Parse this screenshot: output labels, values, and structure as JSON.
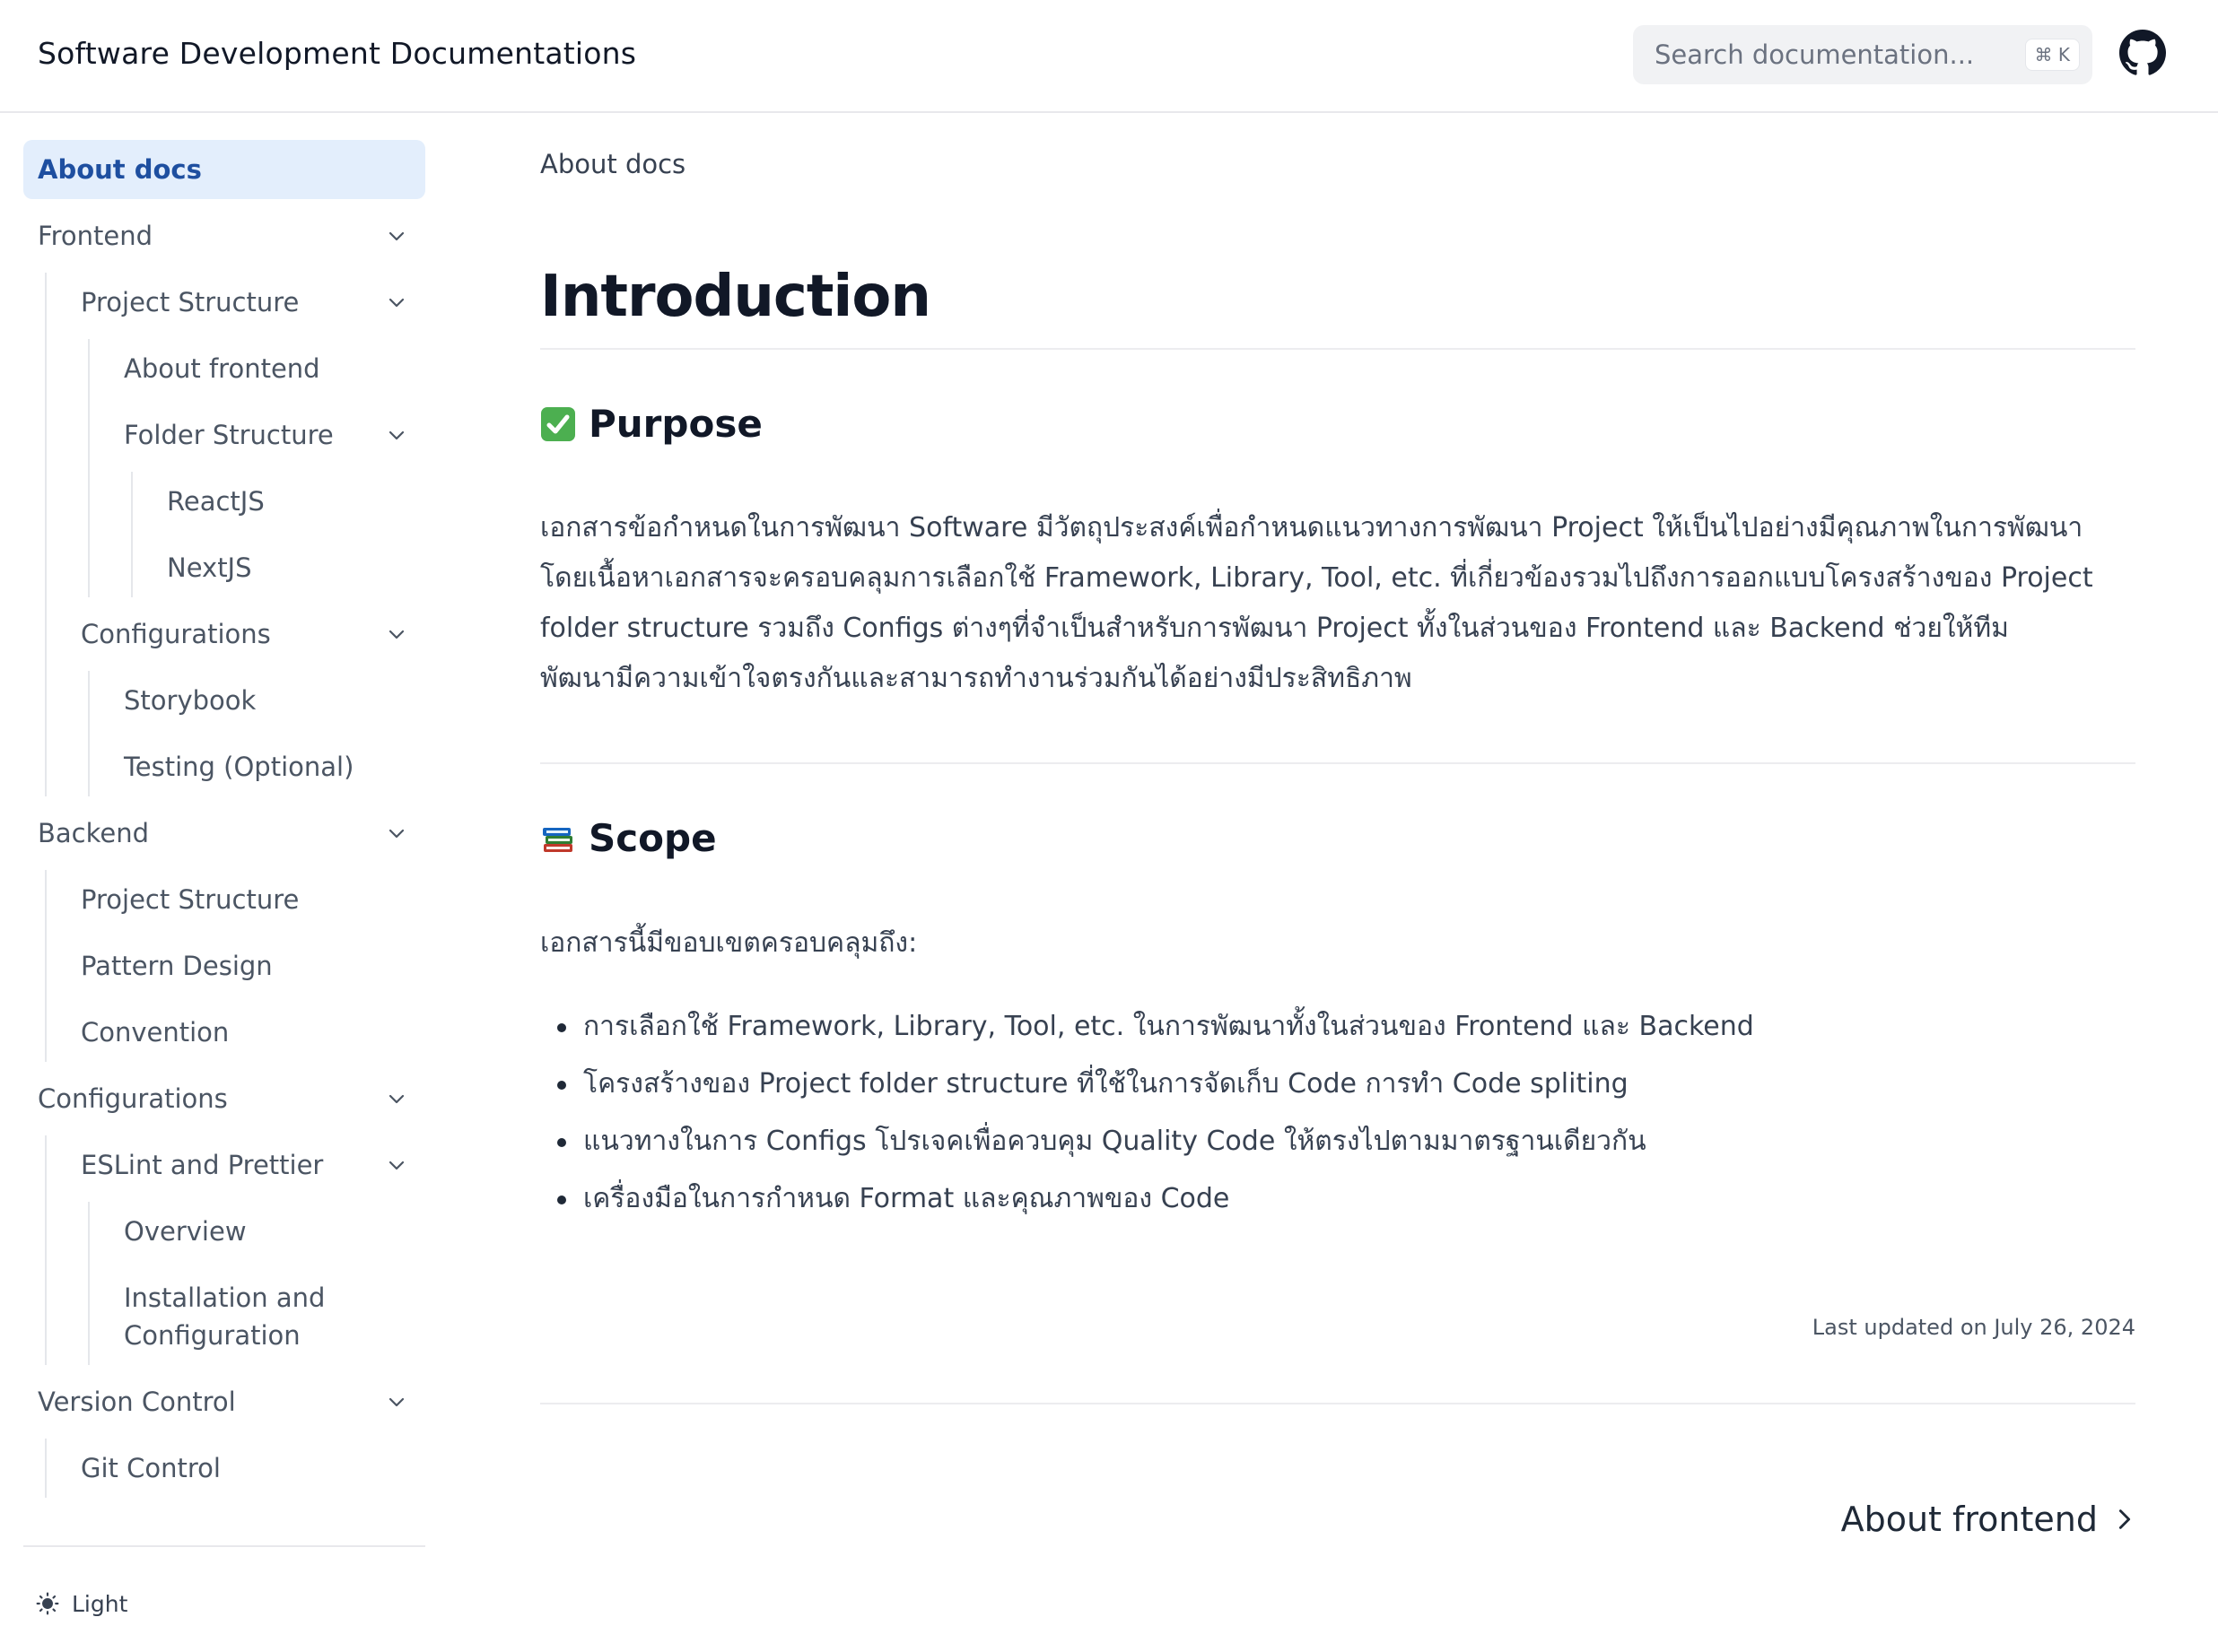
{
  "header": {
    "site_title": "Software Development Documentations",
    "search_placeholder": "Search documentation...",
    "search_shortcut": "⌘ K",
    "github_icon": "github-icon"
  },
  "sidebar": {
    "items": [
      {
        "label": "About docs",
        "level": 0,
        "active": true,
        "expandable": false
      },
      {
        "label": "Frontend",
        "level": 0,
        "expandable": true
      },
      {
        "label": "Project Structure",
        "level": 1,
        "expandable": true
      },
      {
        "label": "About frontend",
        "level": 2,
        "expandable": false
      },
      {
        "label": "Folder Structure",
        "level": 2,
        "expandable": true
      },
      {
        "label": "ReactJS",
        "level": 3,
        "expandable": false
      },
      {
        "label": "NextJS",
        "level": 3,
        "expandable": false
      },
      {
        "label": "Configurations",
        "level": 1,
        "expandable": true
      },
      {
        "label": "Storybook",
        "level": 2,
        "expandable": false
      },
      {
        "label": "Testing (Optional)",
        "level": 2,
        "expandable": false
      },
      {
        "label": "Backend",
        "level": 0,
        "expandable": true
      },
      {
        "label": "Project Structure",
        "level": 1,
        "expandable": false
      },
      {
        "label": "Pattern Design",
        "level": 1,
        "expandable": false
      },
      {
        "label": "Convention",
        "level": 1,
        "expandable": false
      },
      {
        "label": "Configurations",
        "level": 0,
        "expandable": true
      },
      {
        "label": "ESLint and Prettier",
        "level": 1,
        "expandable": true
      },
      {
        "label": "Overview",
        "level": 2,
        "expandable": false
      },
      {
        "label": "Installation and",
        "label2": "Configuration",
        "level": 2,
        "expandable": false
      },
      {
        "label": "Version Control",
        "level": 0,
        "expandable": true
      },
      {
        "label": "Git Control",
        "level": 1,
        "expandable": false
      }
    ],
    "theme_label": "Light",
    "theme_icon": "sun-icon"
  },
  "main": {
    "breadcrumb": "About docs",
    "title": "Introduction",
    "purpose": {
      "heading": "Purpose",
      "emoji_icon": "check-mark-button-icon",
      "lines": [
        "เอกสารข้อกำหนดในการพัฒนา Software มีวัตถุประสงค์เพื่อกำหนดแนวทางการพัฒนา Project ให้เป็นไปอย่างมีคุณภาพในการพัฒนา",
        "โดยเนื้อหาเอกสารจะครอบคลุมการเลือกใช้ Framework, Library, Tool, etc. ที่เกี่ยวข้องรวมไปถึงการออกแบบโครงสร้างของ Project",
        "folder structure รวมถึง Configs ต่างๆที่จำเป็นสำหรับการพัฒนา Project ทั้งในส่วนของ Frontend และ Backend ช่วยให้ทีม",
        "พัฒนามีความเข้าใจตรงกันและสามารถทำงานร่วมกันได้อย่างมีประสิทธิภาพ"
      ]
    },
    "scope": {
      "heading": "Scope",
      "emoji_icon": "books-icon",
      "intro": "เอกสารนี้มีขอบเขตครอบคลุมถึง:",
      "bullets": [
        "การเลือกใช้ Framework, Library, Tool, etc. ในการพัฒนาทั้งในส่วนของ Frontend และ Backend",
        "โครงสร้างของ Project folder structure ที่ใช้ในการจัดเก็บ Code การทำ Code spliting",
        "แนวทางในการ Configs โปรเจคเพื่อควบคุม Quality Code ให้ตรงไปตามมาตรฐานเดียวกัน",
        "เครื่องมือในการกำหนด Format และคุณภาพของ Code"
      ]
    },
    "last_updated": "Last updated on July 26, 2024",
    "next_page": "About frontend"
  },
  "colors": {
    "accent": "#1e4fa0",
    "active_bg": "#e3eefc",
    "text": "#374151",
    "heading": "#111827"
  }
}
